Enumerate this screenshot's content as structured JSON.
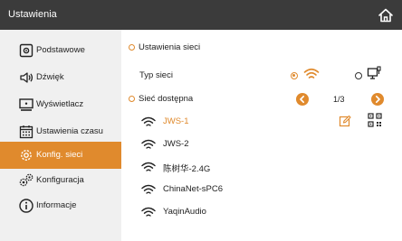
{
  "header": {
    "title": "Ustawienia",
    "home_icon": "home-icon"
  },
  "colors": {
    "accent": "#e08a2d",
    "topbar": "#3b3b3b",
    "sidebar_bg": "#f0f0f0"
  },
  "sidebar": {
    "items": [
      {
        "label": "Podstawowe",
        "icon": "basic-settings-icon",
        "active": false
      },
      {
        "label": "Dźwięk",
        "icon": "speaker-icon",
        "active": false
      },
      {
        "label": "Wyświetlacz",
        "icon": "monitor-icon",
        "active": false
      },
      {
        "label": "Ustawienia czasu",
        "icon": "calendar-icon",
        "active": false
      },
      {
        "label": "Konfig. sieci",
        "icon": "network-gear-icon",
        "active": true
      },
      {
        "label": "Konfiguracja",
        "icon": "gears-icon",
        "active": false
      },
      {
        "label": "Informacje",
        "icon": "info-icon",
        "active": false
      }
    ]
  },
  "main": {
    "network_settings": {
      "title": "Ustawienia sieci",
      "network_type_label": "Typ sieci",
      "options": [
        {
          "type": "wifi",
          "icon": "wifi-icon",
          "selected": true
        },
        {
          "type": "wired",
          "icon": "ethernet-icon",
          "selected": false
        }
      ]
    },
    "available": {
      "title": "Sieć dostępna",
      "page": "1/3",
      "networks": [
        {
          "name": "JWS-1",
          "connected": true
        },
        {
          "name": "JWS-2",
          "connected": false
        },
        {
          "name": "陈树华-2.4G",
          "connected": false
        },
        {
          "name": "ChinaNet-sPC6",
          "connected": false
        },
        {
          "name": "YaqinAudio",
          "connected": false
        }
      ]
    }
  }
}
